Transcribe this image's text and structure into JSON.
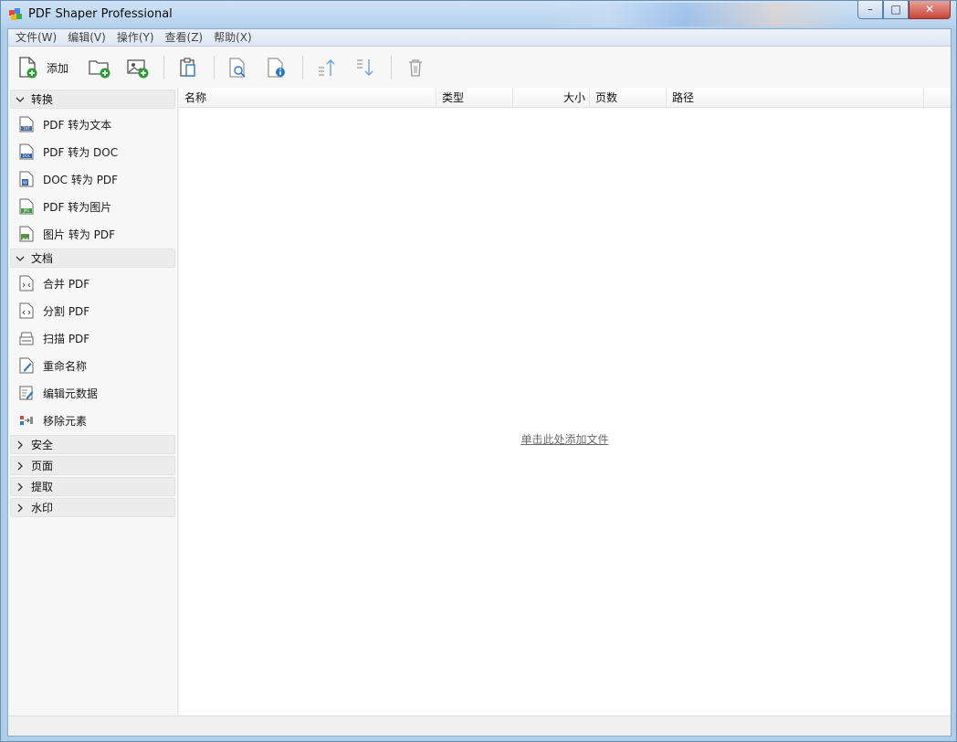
{
  "window": {
    "title": "PDF Shaper Professional",
    "min_glyph": "–",
    "max_glyph": "□",
    "close_glyph": "✕"
  },
  "menu": [
    "文件(W)",
    "编辑(V)",
    "操作(Y)",
    "查看(Z)",
    "帮助(X)"
  ],
  "toolbar": {
    "add_label": "添加",
    "buttons": [
      "add-file-icon",
      "add-folder-icon",
      "add-image-icon",
      "clipboard-icon",
      "preview-icon",
      "file-info-icon",
      "move-up-icon",
      "move-down-icon",
      "delete-icon"
    ]
  },
  "sidebar": {
    "groups": [
      {
        "label": "转换",
        "expanded": true,
        "items": [
          "PDF 转为文本",
          "PDF 转为 DOC",
          "DOC 转为 PDF",
          "PDF 转为图片",
          "图片 转为 PDF"
        ]
      },
      {
        "label": "文档",
        "expanded": true,
        "items": [
          "合并 PDF",
          "分割 PDF",
          "扫描 PDF",
          "重命名称",
          "编辑元数据",
          "移除元素"
        ]
      },
      {
        "label": "安全",
        "expanded": false,
        "items": []
      },
      {
        "label": "页面",
        "expanded": false,
        "items": []
      },
      {
        "label": "提取",
        "expanded": false,
        "items": []
      },
      {
        "label": "水印",
        "expanded": false,
        "items": []
      }
    ]
  },
  "list": {
    "columns": [
      "名称",
      "类型",
      "大小",
      "页数",
      "路径"
    ],
    "empty_text": "单击此处添加文件"
  },
  "colors": {
    "accent_green": "#2e9a3c",
    "icon_blue": "#2f76c5",
    "icon_gray": "#8a8a8a"
  }
}
